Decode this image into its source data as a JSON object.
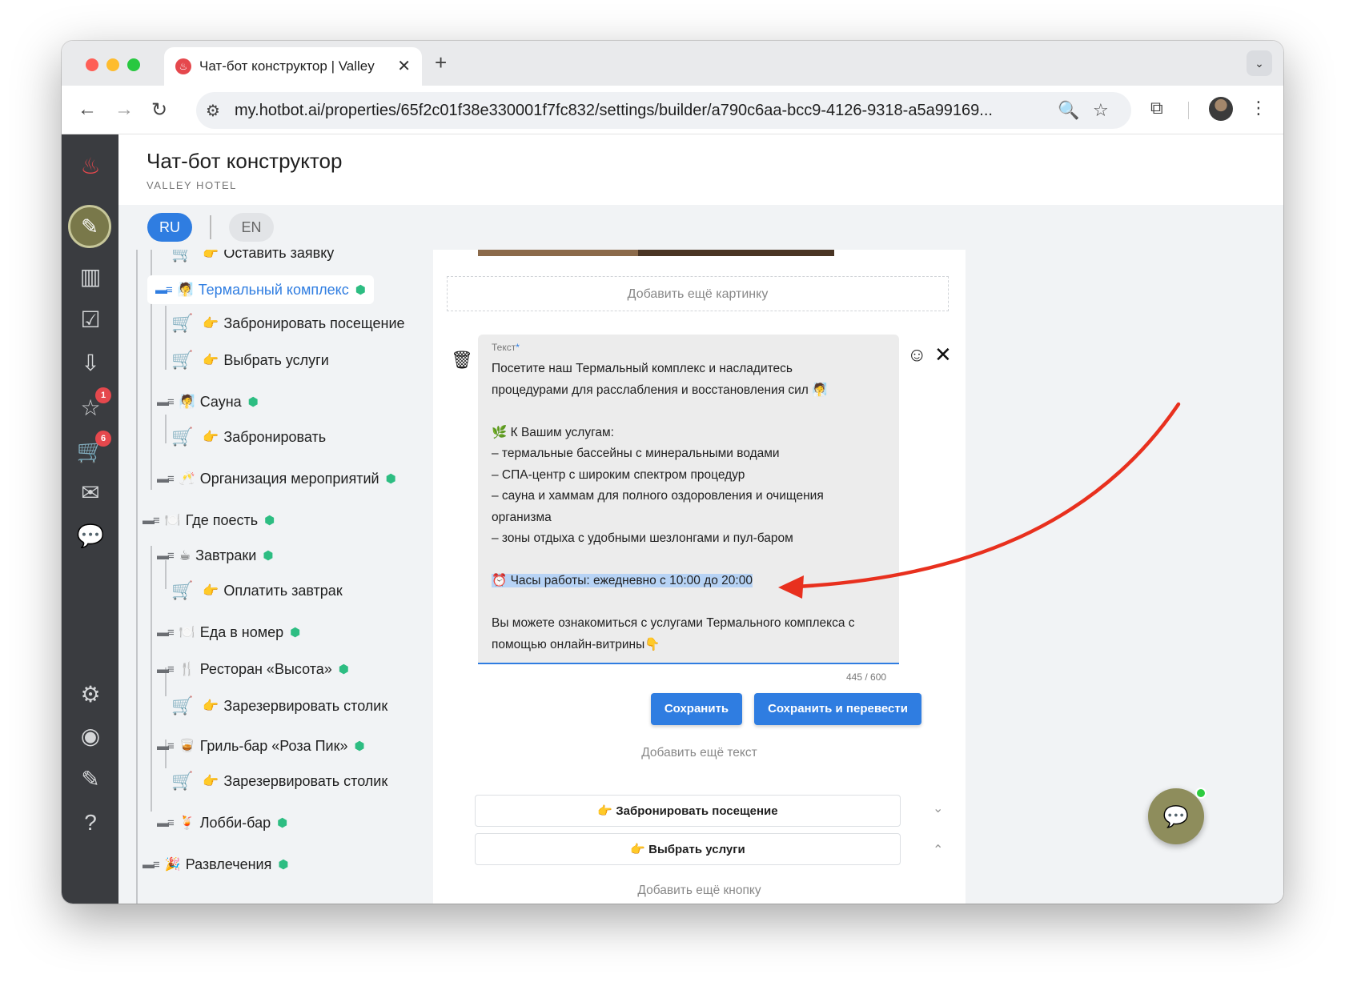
{
  "browser": {
    "tab_title": "Чат-бот конструктор | Valley",
    "tab_close": "✕",
    "new_tab": "+",
    "url": "my.hotbot.ai/properties/65f2c01f38e330001f7fc832/settings/builder/a790c6aa-bcc9-4126-9318-a5a99169..."
  },
  "header": {
    "title": "Чат-бот конструктор",
    "subtitle": "VALLEY HOTEL"
  },
  "languages": [
    "RU",
    "EN"
  ],
  "leftnav": {
    "badges": {
      "rating": "1",
      "cart": "6"
    }
  },
  "tree": [
    {
      "label": "Оставить заявку",
      "emoji": "👉"
    },
    {
      "label": "Термальный комплекс",
      "emoji": "🧖"
    },
    {
      "label": "Забронировать посещение",
      "emoji": "👉"
    },
    {
      "label": "Выбрать услуги",
      "emoji": "👉"
    },
    {
      "label": "Сауна",
      "emoji": "🧖"
    },
    {
      "label": "Забронировать",
      "emoji": "👉"
    },
    {
      "label": "Организация мероприятий",
      "emoji": "🥂"
    },
    {
      "label": "Где поесть",
      "emoji": "🍽️"
    },
    {
      "label": "Завтраки",
      "emoji": "☕"
    },
    {
      "label": "Оплатить завтрак",
      "emoji": "👉"
    },
    {
      "label": "Еда в номер",
      "emoji": "🍽️"
    },
    {
      "label": "Ресторан «Высота»",
      "emoji": "🍴"
    },
    {
      "label": "Зарезервировать столик",
      "emoji": "👉"
    },
    {
      "label": "Гриль-бар «Роза Пик»",
      "emoji": "🥃"
    },
    {
      "label": "Зарезервировать столик",
      "emoji": "👉"
    },
    {
      "label": "Лобби-бар",
      "emoji": "🍹"
    },
    {
      "label": "Развлечения",
      "emoji": "🎉"
    }
  ],
  "editor": {
    "add_picture": "Добавить ещё картинку",
    "text_label": "Текст",
    "required_mark": "*",
    "text_lines": [
      "Посетите наш Термальный комплекс и насладитесь",
      "процедурами для расслабления и восстановления сил 🧖",
      "",
      "🌿 К Вашим услугам:",
      "– термальные бассейны с минеральными водами",
      "– СПА-центр с широким спектром процедур",
      "– сауна и хаммам для полного оздоровления и очищения",
      "организма",
      "– зоны отдыха с удобными шезлонгами и пул-баром",
      "",
      "⏰ Часы работы: ежедневно с 10:00 до 20:00",
      "",
      "Вы можете ознакомиться с услугами Термального комплекса с",
      "помощью онлайн-витрины👇"
    ],
    "counter": "445 / 600",
    "save": "Сохранить",
    "save_translate": "Сохранить и перевести",
    "add_text": "Добавить ещё текст",
    "buttons": [
      "👉 Забронировать посещение",
      "👉 Выбрать услуги"
    ],
    "add_button": "Добавить ещё кнопку"
  },
  "colors": {
    "accent": "#2f7de1",
    "arrow": "#e8301e",
    "sidebar": "#3a3c40"
  }
}
